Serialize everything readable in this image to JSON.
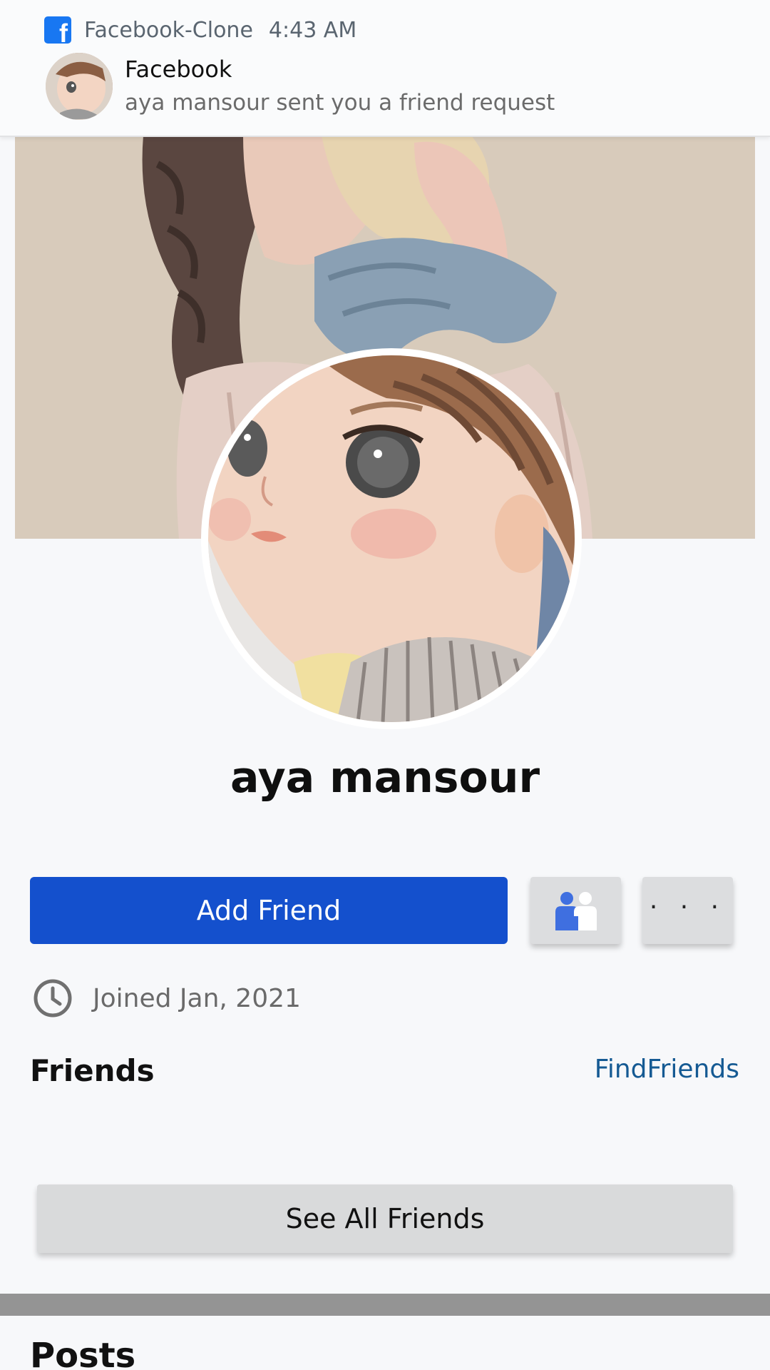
{
  "notification": {
    "app_name": "Facebook-Clone",
    "time": "4:43 AM",
    "title": "Facebook",
    "message": "aya mansour sent you a friend request",
    "logo_glyph": "f",
    "logo_color": "#1877f2"
  },
  "profile": {
    "name": "aya mansour",
    "joined": "Joined Jan, 2021"
  },
  "actions": {
    "add_friend_label": "Add Friend",
    "friends_icon": "friends-icon",
    "more_label": "· · ·",
    "accent_color": "#1450cd"
  },
  "friends": {
    "title": "Friends",
    "find_friends_label": "FindFriends",
    "see_all_label": "See All Friends"
  },
  "posts": {
    "title": "Posts"
  }
}
